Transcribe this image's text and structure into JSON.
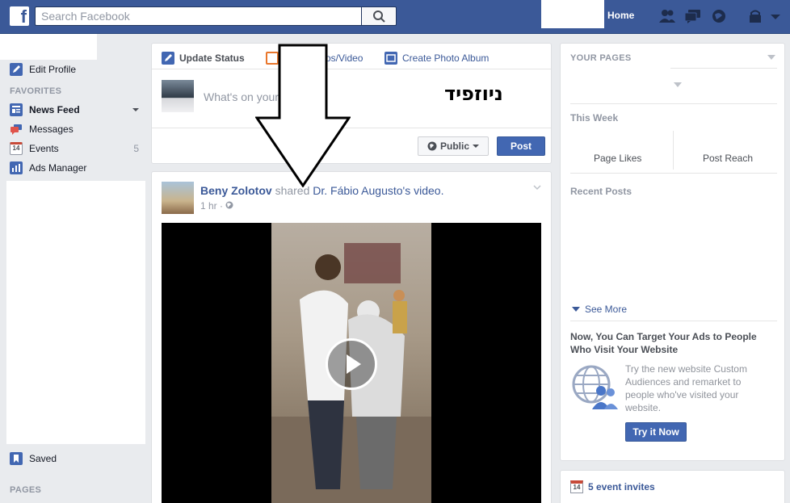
{
  "topbar": {
    "logo": "f",
    "search_placeholder": "Search Facebook",
    "home_label": "Home",
    "icons": [
      "search-icon",
      "friend-requests-icon",
      "messages-icon",
      "notifications-icon",
      "privacy-icon",
      "account-menu-icon"
    ]
  },
  "sidebar": {
    "edit_profile": "Edit Profile",
    "favorites_heading": "FAVORITES",
    "items": [
      {
        "label": "News Feed",
        "icon": "news-feed-icon",
        "count": ""
      },
      {
        "label": "Messages",
        "icon": "messages-icon",
        "count": ""
      },
      {
        "label": "Events",
        "icon": "events-icon",
        "count": "5"
      },
      {
        "label": "Ads Manager",
        "icon": "ads-manager-icon",
        "count": ""
      }
    ],
    "saved": "Saved",
    "pages_heading": "PAGES"
  },
  "composer": {
    "tab_update_status": "Update Status",
    "tab_photo_video": "Add Photos/Video",
    "tab_photo_video_visible": "os/Video",
    "tab_create_album": "Create Photo Album",
    "placeholder": "What's on your",
    "overlay_text": "ניוזפיד",
    "audience": "Public",
    "post_button": "Post"
  },
  "post": {
    "author": "Beny Zolotov",
    "action": "shared",
    "source": "Dr. Fábio Augusto's video.",
    "time": "1 hr",
    "audience_icon": "globe-icon"
  },
  "right": {
    "your_pages": "YOUR PAGES",
    "this_week": "This Week",
    "page_likes": "Page Likes",
    "post_reach": "Post Reach",
    "recent_posts": "Recent Posts",
    "see_more": "See More",
    "ad_title": "Now, You Can Target Your Ads to People Who Visit Your Website",
    "ad_text": "Try the new website Custom Audiences and remarket to people who've visited your website.",
    "try_button": "Try it Now",
    "event_invites": "5 event invites",
    "event_icon_day": "14"
  },
  "colors": {
    "brand": "#3b5998",
    "button": "#4267b2",
    "background": "#e9ebee"
  }
}
